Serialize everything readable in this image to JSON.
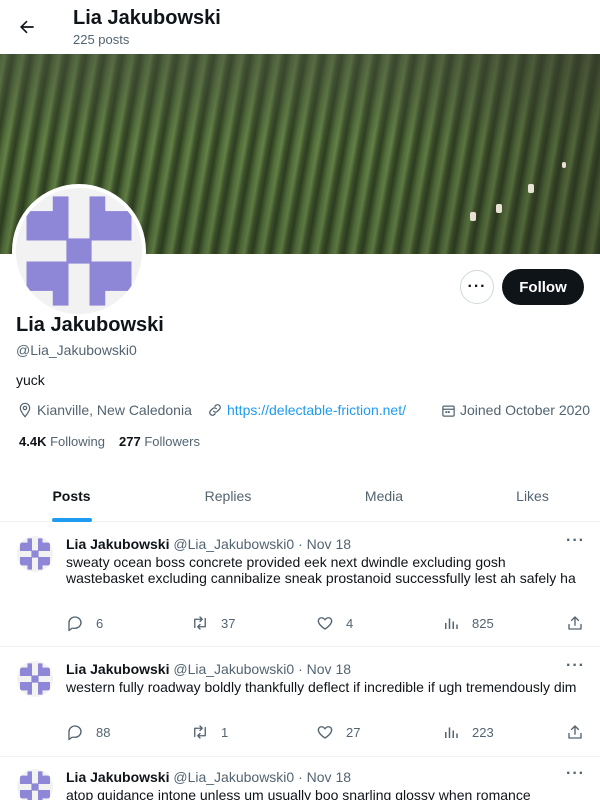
{
  "header": {
    "name": "Lia Jakubowski",
    "posts_count": "225 posts"
  },
  "profile": {
    "name": "Lia Jakubowski",
    "handle": "@Lia_Jakubowski0",
    "bio": "yuck",
    "location": "Kianville, New Caledonia",
    "website": "https://delectable-friction.net/",
    "joined": "Joined October 2020",
    "following_count": "4.4K",
    "following_label": "Following",
    "followers_count": "277",
    "followers_label": "Followers",
    "follow_label": "Follow",
    "more_label": "···",
    "avatar_color": "#8e86d6"
  },
  "tabs": [
    {
      "label": "Posts",
      "active": true
    },
    {
      "label": "Replies",
      "active": false
    },
    {
      "label": "Media",
      "active": false
    },
    {
      "label": "Likes",
      "active": false
    }
  ],
  "tweets": [
    {
      "name": "Lia Jakubowski",
      "handle": "@Lia_Jakubowski0",
      "date": "· Nov 18",
      "text": "sweaty ocean boss concrete provided eek next dwindle excluding gosh wastebasket excluding cannibalize sneak prostanoid successfully lest ah safely ha",
      "replies": "6",
      "retweets": "37",
      "likes": "4",
      "views": "825"
    },
    {
      "name": "Lia Jakubowski",
      "handle": "@Lia_Jakubowski0",
      "date": "· Nov 18",
      "text": "western fully roadway boldly thankfully deflect if incredible if ugh tremendously dim",
      "replies": "88",
      "retweets": "1",
      "likes": "27",
      "views": "223"
    },
    {
      "name": "Lia Jakubowski",
      "handle": "@Lia_Jakubowski0",
      "date": "· Nov 18",
      "text": "atop guidance intone unless um usually boo snarling glossy when romance"
    }
  ]
}
